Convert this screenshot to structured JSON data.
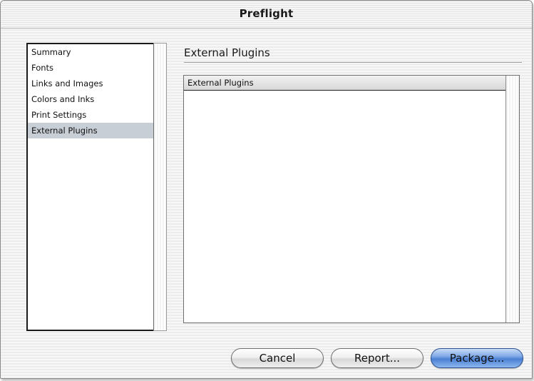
{
  "window": {
    "title": "Preflight"
  },
  "sidebar": {
    "items": [
      {
        "label": "Summary",
        "selected": false
      },
      {
        "label": "Fonts",
        "selected": false
      },
      {
        "label": "Links and Images",
        "selected": false
      },
      {
        "label": "Colors and Inks",
        "selected": false
      },
      {
        "label": "Print Settings",
        "selected": false
      },
      {
        "label": "External Plugins",
        "selected": true
      }
    ],
    "selected_color": "#c8ced6"
  },
  "panel": {
    "title": "External Plugins",
    "table": {
      "columns": [
        "External Plugins"
      ],
      "rows": []
    }
  },
  "buttons": {
    "cancel": "Cancel",
    "report": "Report...",
    "package": "Package...",
    "default_color": "#4b7fd3"
  }
}
